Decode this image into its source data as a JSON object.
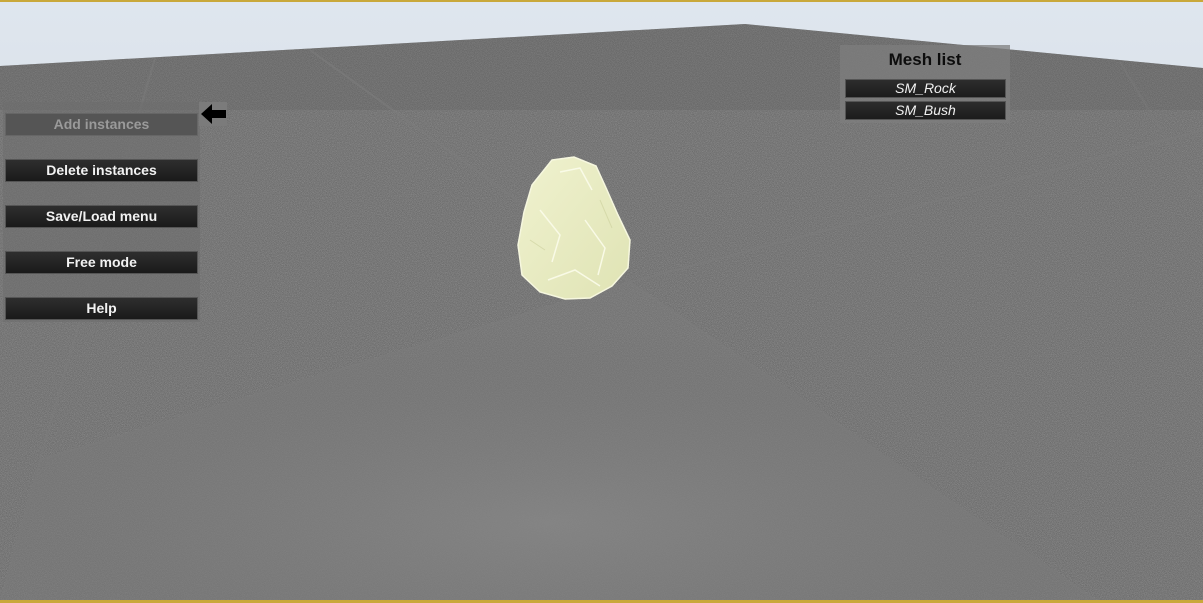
{
  "side_menu": {
    "items": [
      {
        "label": "Add instances",
        "state": "disabled"
      },
      {
        "label": "Delete instances",
        "state": "enabled"
      },
      {
        "label": "Save/Load menu",
        "state": "enabled"
      },
      {
        "label": "Free mode",
        "state": "enabled"
      },
      {
        "label": "Help",
        "state": "enabled"
      }
    ],
    "indicator_icon": "arrow-left-icon"
  },
  "mesh_list": {
    "title": "Mesh list",
    "items": [
      {
        "label": "SM_Rock"
      },
      {
        "label": "SM_Bush"
      }
    ]
  },
  "scene": {
    "object": "rock-mesh",
    "colors": {
      "sky": "#dfe6ee",
      "floor": "#6a6a6a",
      "rock": "#e6e9be",
      "frame_border": "#c9a83a"
    }
  }
}
